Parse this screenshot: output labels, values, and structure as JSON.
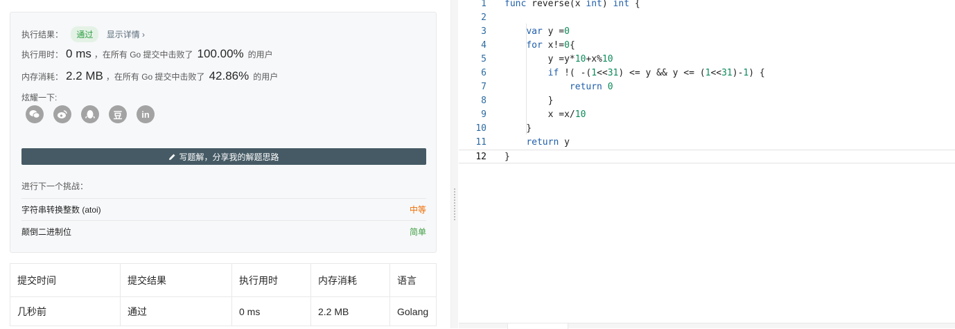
{
  "result": {
    "status_label": "执行结果：",
    "status_badge": "通过",
    "detail_link": "显示详情 ›",
    "runtime_label": "执行用时：",
    "runtime_value": "0 ms",
    "runtime_mid": "，在所有 Go 提交中击败了",
    "runtime_pct": "100.00%",
    "runtime_suffix": "的用户",
    "memory_label": "内存消耗：",
    "memory_value": "2.2 MB",
    "memory_mid": "，在所有 Go 提交中击败了",
    "memory_pct": "42.86%",
    "memory_suffix": "的用户",
    "share_label": "炫耀一下:",
    "share_icons": [
      "wechat-icon",
      "weibo-icon",
      "qq-icon",
      "douban-icon",
      "linkedin-icon"
    ],
    "douban_glyph": "豆",
    "linkedin_glyph": "in",
    "write_button": "写题解，分享我的解题思路",
    "next_label": "进行下一个挑战：",
    "challenges": [
      {
        "title": "字符串转换整数 (atoi)",
        "difficulty": "中等"
      },
      {
        "title": "颠倒二进制位",
        "difficulty": "简单"
      }
    ]
  },
  "table": {
    "headers": [
      "提交时间",
      "提交结果",
      "执行用时",
      "内存消耗",
      "语言"
    ],
    "rows": [
      {
        "time": "几秒前",
        "result": "通过",
        "runtime": "0 ms",
        "memory": "2.2 MB",
        "language": "Golang"
      }
    ]
  },
  "editor": {
    "line_numbers": [
      "1",
      "2",
      "3",
      "4",
      "5",
      "6",
      "7",
      "8",
      "9",
      "10",
      "11",
      "12"
    ],
    "active_line": 12,
    "lines": [
      [
        {
          "k": "kw",
          "t": "func"
        },
        {
          "t": " reverse(x "
        },
        {
          "k": "kw",
          "t": "int"
        },
        {
          "t": ") "
        },
        {
          "k": "kw",
          "t": "int"
        },
        {
          "t": " {"
        }
      ],
      [],
      [
        {
          "t": "    "
        },
        {
          "k": "kw",
          "t": "var"
        },
        {
          "t": " y ="
        },
        {
          "k": "num",
          "t": "0"
        }
      ],
      [
        {
          "t": "    "
        },
        {
          "k": "kw",
          "t": "for"
        },
        {
          "t": " x!="
        },
        {
          "k": "num",
          "t": "0"
        },
        {
          "t": "{"
        }
      ],
      [
        {
          "t": "        y =y*"
        },
        {
          "k": "num",
          "t": "10"
        },
        {
          "t": "+x%"
        },
        {
          "k": "num",
          "t": "10"
        }
      ],
      [
        {
          "t": "        "
        },
        {
          "k": "kw",
          "t": "if"
        },
        {
          "t": " !( -("
        },
        {
          "k": "num",
          "t": "1"
        },
        {
          "t": "<<"
        },
        {
          "k": "num",
          "t": "31"
        },
        {
          "t": ") <= y && y <= ("
        },
        {
          "k": "num",
          "t": "1"
        },
        {
          "t": "<<"
        },
        {
          "k": "num",
          "t": "31"
        },
        {
          "t": ")-"
        },
        {
          "k": "num",
          "t": "1"
        },
        {
          "t": ") {"
        }
      ],
      [
        {
          "t": "            "
        },
        {
          "k": "kw",
          "t": "return"
        },
        {
          "t": " "
        },
        {
          "k": "num",
          "t": "0"
        }
      ],
      [
        {
          "t": "        }"
        }
      ],
      [
        {
          "t": "        x =x/"
        },
        {
          "k": "num",
          "t": "10"
        }
      ],
      [
        {
          "t": "    }"
        }
      ],
      [
        {
          "t": "    "
        },
        {
          "k": "kw",
          "t": "return"
        },
        {
          "t": " y"
        }
      ],
      [
        {
          "t": "}"
        }
      ]
    ]
  }
}
